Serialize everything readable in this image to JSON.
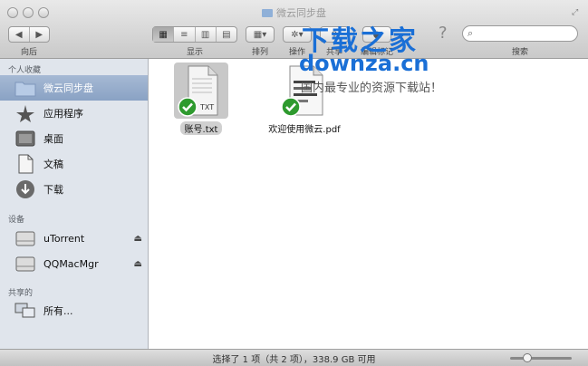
{
  "window": {
    "title": "微云同步盘"
  },
  "toolbar": {
    "back_label": "向后",
    "view_label": "显示",
    "arrange_label": "排列",
    "action_label": "操作",
    "share_label": "共享",
    "tags_label": "编辑标记",
    "search_label": "搜索",
    "search_placeholder": "",
    "help_glyph": "?"
  },
  "watermark": {
    "line1": "下载之家",
    "line2": "downza.cn",
    "line3": "国内最专业的资源下载站！"
  },
  "sidebar": {
    "favorites_header": "个人收藏",
    "favorites": [
      {
        "label": "微云同步盘",
        "icon": "folder-icon",
        "selected": true
      },
      {
        "label": "应用程序",
        "icon": "applications-icon",
        "selected": false
      },
      {
        "label": "桌面",
        "icon": "desktop-icon",
        "selected": false
      },
      {
        "label": "文稿",
        "icon": "documents-icon",
        "selected": false
      },
      {
        "label": "下载",
        "icon": "downloads-icon",
        "selected": false
      }
    ],
    "devices_header": "设备",
    "devices": [
      {
        "label": "uTorrent",
        "icon": "disk-icon"
      },
      {
        "label": "QQMacMgr",
        "icon": "disk-icon"
      }
    ],
    "shared_header": "共享的",
    "shared": [
      {
        "label": "所有...",
        "icon": "network-icon"
      }
    ]
  },
  "files": [
    {
      "name": "账号.txt",
      "type": "txt",
      "badge": "TXT",
      "selected": true,
      "synced": true
    },
    {
      "name": "欢迎使用微云.pdf",
      "type": "pdf",
      "selected": false,
      "synced": true
    }
  ],
  "status": {
    "text": "选择了 1 项（共 2 项），338.9 GB 可用"
  },
  "colors": {
    "accent": "#1a6fd6",
    "sync_check": "#2e9a2e",
    "sidebar_selected": "#8aa2c4"
  }
}
